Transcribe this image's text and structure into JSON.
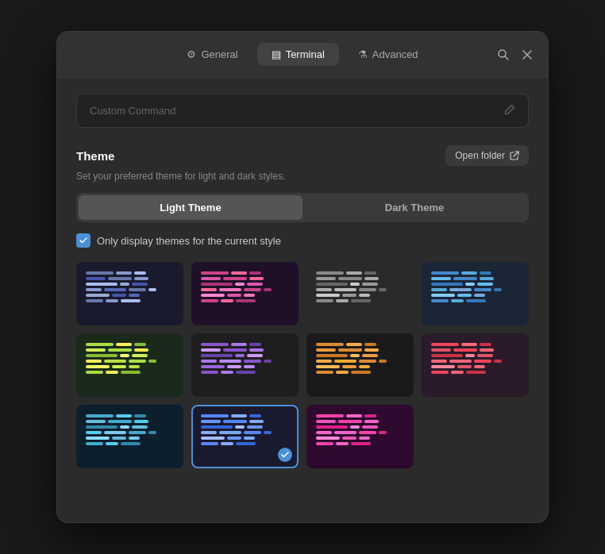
{
  "window": {
    "tabs": [
      {
        "id": "general",
        "label": "General",
        "icon": "⚙",
        "active": false
      },
      {
        "id": "terminal",
        "label": "Terminal",
        "icon": "▤",
        "active": true
      },
      {
        "id": "advanced",
        "label": "Advanced",
        "icon": "⚗",
        "active": false
      }
    ],
    "search_icon": "🔍",
    "close_icon": "✕"
  },
  "custom_command": {
    "placeholder": "Custom Command",
    "edit_icon": "✏"
  },
  "theme_section": {
    "title": "Theme",
    "description": "Set your preferred theme for light and dark styles.",
    "open_folder_label": "Open folder",
    "open_folder_icon": "↗",
    "light_theme_label": "Light Theme",
    "dark_theme_label": "Dark Theme",
    "active_tab": "dark",
    "checkbox_label": "Only display themes for the current style",
    "checkbox_checked": true
  },
  "themes": [
    {
      "id": 1,
      "bg": "#1a1a2e",
      "selected": false,
      "lines": [
        {
          "segs": [
            {
              "w": 30,
              "c": "#5a6a8a"
            },
            {
              "w": 18,
              "c": "#7a8aaa"
            },
            {
              "w": 22,
              "c": "#5a6a8a"
            }
          ]
        },
        {
          "segs": [
            {
              "w": 20,
              "c": "#6a7aaa"
            },
            {
              "w": 28,
              "c": "#8a9aba"
            },
            {
              "w": 15,
              "c": "#5a6a8a"
            }
          ]
        },
        {
          "segs": [
            {
              "w": 35,
              "c": "#4a5a7a"
            },
            {
              "w": 12,
              "c": "#7a8aaa"
            }
          ]
        },
        {
          "segs": [
            {
              "w": 22,
              "c": "#8899cc"
            },
            {
              "w": 30,
              "c": "#5a6a8a"
            },
            {
              "w": 18,
              "c": "#aabbdd"
            }
          ]
        },
        {
          "segs": [
            {
              "w": 15,
              "c": "#6a7aaa"
            },
            {
              "w": 20,
              "c": "#889aaa"
            }
          ]
        }
      ]
    },
    {
      "id": 2,
      "bg": "#1f1028",
      "selected": false,
      "lines": [
        {
          "segs": [
            {
              "w": 25,
              "c": "#cc4488"
            },
            {
              "w": 18,
              "c": "#ff6699"
            },
            {
              "w": 22,
              "c": "#aa3377"
            }
          ]
        },
        {
          "segs": [
            {
              "w": 30,
              "c": "#dd55aa"
            },
            {
              "w": 20,
              "c": "#cc4488"
            },
            {
              "w": 15,
              "c": "#ff88cc"
            }
          ]
        },
        {
          "segs": [
            {
              "w": 18,
              "c": "#aa3377"
            },
            {
              "w": 28,
              "c": "#dd55aa"
            },
            {
              "w": 20,
              "c": "#cc4488"
            }
          ]
        },
        {
          "segs": [
            {
              "w": 35,
              "c": "#ff6699"
            },
            {
              "w": 12,
              "c": "#aa3377"
            }
          ]
        },
        {
          "segs": [
            {
              "w": 22,
              "c": "#dd55aa"
            },
            {
              "w": 18,
              "c": "#cc4488"
            }
          ]
        }
      ]
    },
    {
      "id": 3,
      "bg": "#2a2a2a",
      "selected": false,
      "lines": [
        {
          "segs": [
            {
              "w": 28,
              "c": "#888888"
            },
            {
              "w": 20,
              "c": "#aaaaaa"
            },
            {
              "w": 22,
              "c": "#666666"
            }
          ]
        },
        {
          "segs": [
            {
              "w": 35,
              "c": "#999999"
            },
            {
              "w": 18,
              "c": "#bbbbbb"
            }
          ]
        },
        {
          "segs": [
            {
              "w": 20,
              "c": "#777777"
            },
            {
              "w": 25,
              "c": "#aaaaaa"
            },
            {
              "w": 15,
              "c": "#888888"
            }
          ]
        },
        {
          "segs": [
            {
              "w": 30,
              "c": "#bbbbbb"
            },
            {
              "w": 22,
              "c": "#666666"
            },
            {
              "w": 18,
              "c": "#999999"
            }
          ]
        },
        {
          "segs": [
            {
              "w": 25,
              "c": "#888888"
            },
            {
              "w": 20,
              "c": "#aaaaaa"
            }
          ]
        }
      ]
    },
    {
      "id": 4,
      "bg": "#1a2535",
      "selected": false,
      "lines": [
        {
          "segs": [
            {
              "w": 25,
              "c": "#4488cc"
            },
            {
              "w": 18,
              "c": "#55aadd"
            },
            {
              "w": 22,
              "c": "#3377bb"
            }
          ]
        },
        {
          "segs": [
            {
              "w": 30,
              "c": "#66bbee"
            },
            {
              "w": 20,
              "c": "#4488cc"
            },
            {
              "w": 15,
              "c": "#88ccff"
            }
          ]
        },
        {
          "segs": [
            {
              "w": 18,
              "c": "#3377bb"
            },
            {
              "w": 28,
              "c": "#55aadd"
            }
          ]
        },
        {
          "segs": [
            {
              "w": 35,
              "c": "#4488cc"
            },
            {
              "w": 12,
              "c": "#66bbee"
            }
          ]
        },
        {
          "segs": [
            {
              "w": 22,
              "c": "#88ccff"
            },
            {
              "w": 18,
              "c": "#4488cc"
            }
          ]
        }
      ]
    },
    {
      "id": 5,
      "bg": "#1a2a1a",
      "selected": false,
      "lines": [
        {
          "segs": [
            {
              "w": 25,
              "c": "#aadd44"
            },
            {
              "w": 18,
              "c": "#ffee55"
            },
            {
              "w": 22,
              "c": "#88bb33"
            }
          ]
        },
        {
          "segs": [
            {
              "w": 30,
              "c": "#ccee55"
            },
            {
              "w": 20,
              "c": "#aadd44"
            },
            {
              "w": 15,
              "c": "#ffff66"
            }
          ]
        },
        {
          "segs": [
            {
              "w": 18,
              "c": "#88bb33"
            },
            {
              "w": 28,
              "c": "#ddee66"
            }
          ]
        },
        {
          "segs": [
            {
              "w": 35,
              "c": "#aadd44"
            },
            {
              "w": 12,
              "c": "#ccee55"
            }
          ]
        },
        {
          "segs": [
            {
              "w": 22,
              "c": "#ffff66"
            },
            {
              "w": 18,
              "c": "#aadd44"
            }
          ]
        }
      ]
    },
    {
      "id": 6,
      "bg": "#1e1e1e",
      "selected": false,
      "lines": [
        {
          "segs": [
            {
              "w": 25,
              "c": "#8855cc"
            },
            {
              "w": 18,
              "c": "#aa77ee"
            },
            {
              "w": 22,
              "c": "#6644aa"
            }
          ]
        },
        {
          "segs": [
            {
              "w": 30,
              "c": "#cc99ff"
            },
            {
              "w": 20,
              "c": "#8855cc"
            },
            {
              "w": 15,
              "c": "#9966dd"
            }
          ]
        },
        {
          "segs": [
            {
              "w": 18,
              "c": "#6644aa"
            },
            {
              "w": 28,
              "c": "#aa77ee"
            }
          ]
        },
        {
          "segs": [
            {
              "w": 35,
              "c": "#8855cc"
            },
            {
              "w": 12,
              "c": "#cc99ff"
            }
          ]
        },
        {
          "segs": [
            {
              "w": 22,
              "c": "#9966dd"
            },
            {
              "w": 18,
              "c": "#8855cc"
            }
          ]
        }
      ]
    },
    {
      "id": 7,
      "bg": "#1a1a1a",
      "selected": false,
      "lines": [
        {
          "segs": [
            {
              "w": 25,
              "c": "#dd8833"
            },
            {
              "w": 18,
              "c": "#ffaa44"
            },
            {
              "w": 22,
              "c": "#cc7722"
            }
          ]
        },
        {
          "segs": [
            {
              "w": 30,
              "c": "#ee9944"
            },
            {
              "w": 20,
              "c": "#dd8833"
            },
            {
              "w": 15,
              "c": "#ffbb55"
            }
          ]
        },
        {
          "segs": [
            {
              "w": 18,
              "c": "#cc7722"
            },
            {
              "w": 28,
              "c": "#ee9944"
            }
          ]
        },
        {
          "segs": [
            {
              "w": 35,
              "c": "#dd8833"
            },
            {
              "w": 12,
              "c": "#ffaa44"
            }
          ]
        },
        {
          "segs": [
            {
              "w": 22,
              "c": "#ffbb55"
            },
            {
              "w": 18,
              "c": "#dd8833"
            }
          ]
        }
      ]
    },
    {
      "id": 8,
      "bg": "#2a1a2a",
      "selected": false,
      "lines": [
        {
          "segs": [
            {
              "w": 25,
              "c": "#ee4455"
            },
            {
              "w": 18,
              "c": "#ff6677"
            },
            {
              "w": 22,
              "c": "#cc3344"
            }
          ]
        },
        {
          "segs": [
            {
              "w": 30,
              "c": "#dd5566"
            },
            {
              "w": 20,
              "c": "#ee4455"
            },
            {
              "w": 15,
              "c": "#ff8899"
            }
          ]
        },
        {
          "segs": [
            {
              "w": 18,
              "c": "#cc3344"
            },
            {
              "w": 28,
              "c": "#dd5566"
            }
          ]
        },
        {
          "segs": [
            {
              "w": 35,
              "c": "#ee4455"
            },
            {
              "w": 12,
              "c": "#ff6677"
            }
          ]
        },
        {
          "segs": [
            {
              "w": 22,
              "c": "#ff8899"
            },
            {
              "w": 18,
              "c": "#ee4455"
            }
          ]
        }
      ]
    },
    {
      "id": 9,
      "bg": "#0d1f2d",
      "selected": false,
      "lines": [
        {
          "segs": [
            {
              "w": 25,
              "c": "#44aacc"
            },
            {
              "w": 18,
              "c": "#55ccee"
            },
            {
              "w": 22,
              "c": "#3388aa"
            }
          ]
        },
        {
          "segs": [
            {
              "w": 30,
              "c": "#66bbdd"
            },
            {
              "w": 20,
              "c": "#44aacc"
            },
            {
              "w": 15,
              "c": "#88ddff"
            }
          ]
        },
        {
          "segs": [
            {
              "w": 18,
              "c": "#3388aa"
            },
            {
              "w": 28,
              "c": "#55ccee"
            }
          ]
        },
        {
          "segs": [
            {
              "w": 35,
              "c": "#44aacc"
            },
            {
              "w": 12,
              "c": "#66bbdd"
            }
          ]
        },
        {
          "segs": [
            {
              "w": 22,
              "c": "#88ddff"
            },
            {
              "w": 18,
              "c": "#44aacc"
            }
          ]
        }
      ]
    },
    {
      "id": 10,
      "bg": "#1a1a2e",
      "selected": true,
      "lines": [
        {
          "segs": [
            {
              "w": 25,
              "c": "#5588ff"
            },
            {
              "w": 18,
              "c": "#88aaff"
            },
            {
              "w": 22,
              "c": "#3366dd"
            }
          ]
        },
        {
          "segs": [
            {
              "w": 30,
              "c": "#6699ff"
            },
            {
              "w": 20,
              "c": "#5588ff"
            },
            {
              "w": 15,
              "c": "#aabbff"
            }
          ]
        },
        {
          "segs": [
            {
              "w": 18,
              "c": "#3366dd"
            },
            {
              "w": 28,
              "c": "#88aaff"
            }
          ]
        },
        {
          "segs": [
            {
              "w": 35,
              "c": "#5588ff"
            },
            {
              "w": 12,
              "c": "#6699ff"
            }
          ]
        },
        {
          "segs": [
            {
              "w": 22,
              "c": "#aabbff"
            },
            {
              "w": 18,
              "c": "#5588ff"
            }
          ]
        }
      ]
    },
    {
      "id": 11,
      "bg": "#2d0a2d",
      "selected": false,
      "lines": [
        {
          "segs": [
            {
              "w": 25,
              "c": "#ff44aa"
            },
            {
              "w": 18,
              "c": "#ff66cc"
            },
            {
              "w": 22,
              "c": "#dd2288"
            }
          ]
        },
        {
          "segs": [
            {
              "w": 30,
              "c": "#ee55bb"
            },
            {
              "w": 20,
              "c": "#ff44aa"
            },
            {
              "w": 15,
              "c": "#ff88dd"
            }
          ]
        },
        {
          "segs": [
            {
              "w": 18,
              "c": "#dd2288"
            },
            {
              "w": 28,
              "c": "#ee55bb"
            }
          ]
        },
        {
          "segs": [
            {
              "w": 35,
              "c": "#ff44aa"
            },
            {
              "w": 12,
              "c": "#ff66cc"
            }
          ]
        },
        {
          "segs": [
            {
              "w": 22,
              "c": "#ff88dd"
            },
            {
              "w": 18,
              "c": "#ff44aa"
            }
          ]
        }
      ]
    }
  ]
}
